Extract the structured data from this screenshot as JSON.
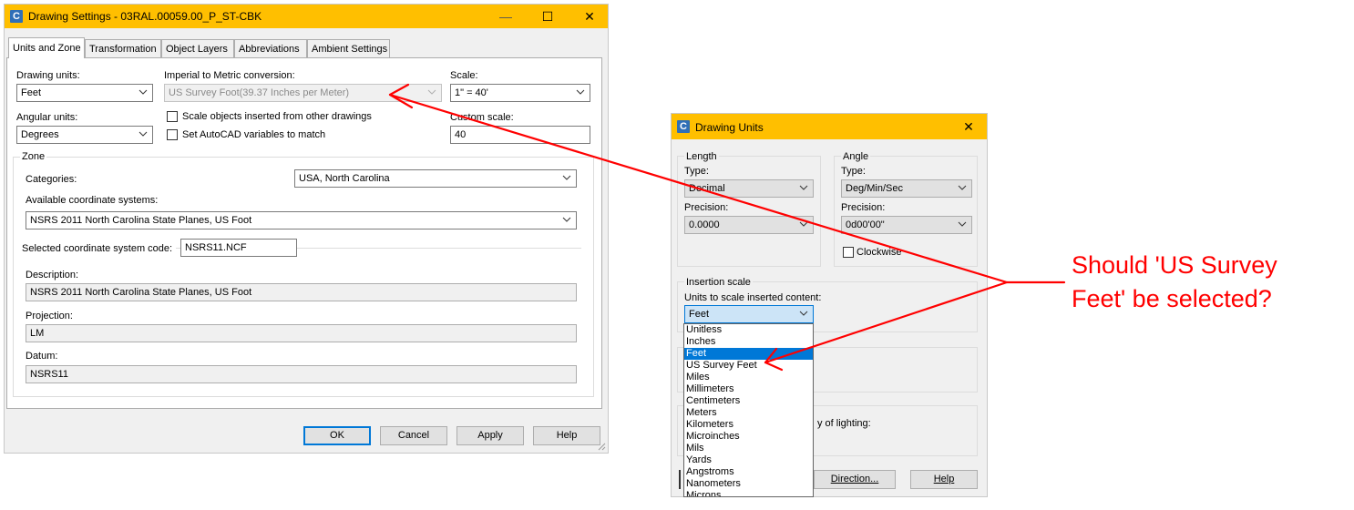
{
  "drawing_settings": {
    "title": "Drawing Settings - 03RAL.00059.00_P_ST-CBK",
    "app_icon": "C",
    "title_buttons": {
      "minimize": "—",
      "maximize": "☐",
      "close": "✕"
    },
    "tabs": [
      "Units and Zone",
      "Transformation",
      "Object Layers",
      "Abbreviations",
      "Ambient Settings"
    ],
    "drawing_units_label": "Drawing units:",
    "drawing_units_value": "Feet",
    "imperial_label": "Imperial to Metric conversion:",
    "imperial_value": "US Survey Foot(39.37 Inches per Meter)",
    "scale_label": "Scale:",
    "scale_value": "1\" = 40'",
    "angular_label": "Angular units:",
    "angular_value": "Degrees",
    "scale_objects_label": "Scale objects inserted from other drawings",
    "set_autocad_label": "Set AutoCAD variables to match",
    "custom_scale_label": "Custom scale:",
    "custom_scale_value": "40",
    "zone_label": "Zone",
    "categories_label": "Categories:",
    "categories_value": "USA, North Carolina",
    "available_label": "Available coordinate systems:",
    "available_value": "NSRS 2011 North Carolina State Planes, US Foot",
    "selected_code_label": "Selected coordinate system code:",
    "selected_code_value": "NSRS11.NCF",
    "description_label": "Description:",
    "description_value": "NSRS 2011 North Carolina State Planes, US Foot",
    "projection_label": "Projection:",
    "projection_value": "LM",
    "datum_label": "Datum:",
    "datum_value": "NSRS11",
    "buttons": {
      "ok": "OK",
      "cancel": "Cancel",
      "apply": "Apply",
      "help": "Help"
    }
  },
  "drawing_units": {
    "title": "Drawing Units",
    "app_icon": "C",
    "close": "✕",
    "length_label": "Length",
    "length_type_label": "Type:",
    "length_type_value": "Decimal",
    "length_precision_label": "Precision:",
    "length_precision_value": "0.0000",
    "angle_label": "Angle",
    "angle_type_label": "Type:",
    "angle_type_value": "Deg/Min/Sec",
    "angle_precision_label": "Precision:",
    "angle_precision_value": "0d00'00\"",
    "clockwise_label": "Clockwise",
    "insertion_label": "Insertion scale",
    "units_to_scale_label": "Units to scale inserted content:",
    "units_value": "Feet",
    "dropdown_options": [
      "Unitless",
      "Inches",
      "Feet",
      "US Survey Feet",
      "Miles",
      "Millimeters",
      "Centimeters",
      "Meters",
      "Kilometers",
      "Microinches",
      "Mils",
      "Yards",
      "Angstroms",
      "Nanometers",
      "Microns"
    ],
    "selected_option": "Feet",
    "lighting_fragment": "y of lighting:",
    "direction_button": "Direction...",
    "help_button": "Help"
  },
  "annotation": {
    "line1": "Should 'US Survey",
    "line2": "Feet' be selected?",
    "color": "#ff0000"
  }
}
